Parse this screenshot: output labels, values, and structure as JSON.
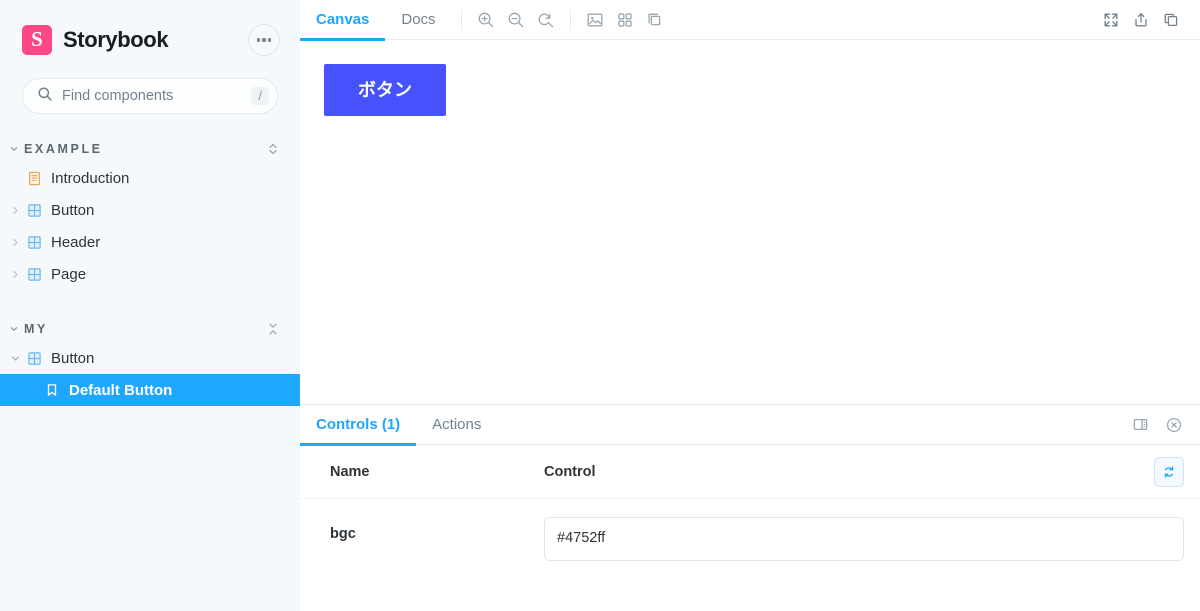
{
  "brand": {
    "title": "Storybook",
    "logo_glyph": "S",
    "logo_color": "#ff4785",
    "menu_icon": "ellipsis-icon"
  },
  "search": {
    "placeholder": "Find components",
    "value": "",
    "icon": "search-icon",
    "shortcut": "/"
  },
  "sidebar": {
    "sections": [
      {
        "label": "EXAMPLE",
        "expanded": true,
        "action_icon": "expand-all-icon",
        "items": [
          {
            "label": "Introduction",
            "icon": "document-icon",
            "type": "doc",
            "expandable": false,
            "expanded": false,
            "selected": false,
            "indent": false
          },
          {
            "label": "Button",
            "icon": "component-icon",
            "type": "component",
            "expandable": true,
            "expanded": false,
            "selected": false,
            "indent": false
          },
          {
            "label": "Header",
            "icon": "component-icon",
            "type": "component",
            "expandable": true,
            "expanded": false,
            "selected": false,
            "indent": false
          },
          {
            "label": "Page",
            "icon": "component-icon",
            "type": "component",
            "expandable": true,
            "expanded": false,
            "selected": false,
            "indent": false
          }
        ]
      },
      {
        "label": "MY",
        "expanded": true,
        "action_icon": "collapse-all-icon",
        "items": [
          {
            "label": "Button",
            "icon": "component-icon",
            "type": "component",
            "expandable": true,
            "expanded": true,
            "selected": false,
            "indent": false
          },
          {
            "label": "Default Button",
            "icon": "story-bookmark-icon",
            "type": "story",
            "expandable": false,
            "expanded": false,
            "selected": true,
            "indent": true
          }
        ]
      }
    ]
  },
  "preview": {
    "tabs": [
      {
        "label": "Canvas",
        "active": true
      },
      {
        "label": "Docs",
        "active": false
      }
    ],
    "tools": [
      {
        "name": "zoom-in-icon"
      },
      {
        "name": "zoom-out-icon"
      },
      {
        "name": "zoom-reset-icon"
      },
      {
        "name": "backgrounds-icon"
      },
      {
        "name": "grid-icon"
      },
      {
        "name": "measure-icon"
      }
    ],
    "right_tools": [
      {
        "name": "fullscreen-icon"
      },
      {
        "name": "share-icon"
      },
      {
        "name": "open-new-tab-icon"
      }
    ],
    "story_button_label": "ボタン",
    "story_button_color": "#4752ff"
  },
  "addons": {
    "tabs": [
      {
        "label": "Controls (1)",
        "active": true
      },
      {
        "label": "Actions",
        "active": false
      }
    ],
    "right_tools": [
      {
        "name": "panel-position-icon"
      },
      {
        "name": "close-panel-icon"
      }
    ],
    "table": {
      "headers": {
        "name": "Name",
        "control": "Control"
      },
      "reset_icon": "reset-controls-icon",
      "rows": [
        {
          "name": "bgc",
          "value": "#4752ff",
          "type": "text"
        }
      ]
    }
  },
  "colors": {
    "accent_blue": "#1ea7fd",
    "brand_pink": "#ff4785",
    "sidebar_bg": "#f6f9fc",
    "button_bg": "#4752ff"
  }
}
